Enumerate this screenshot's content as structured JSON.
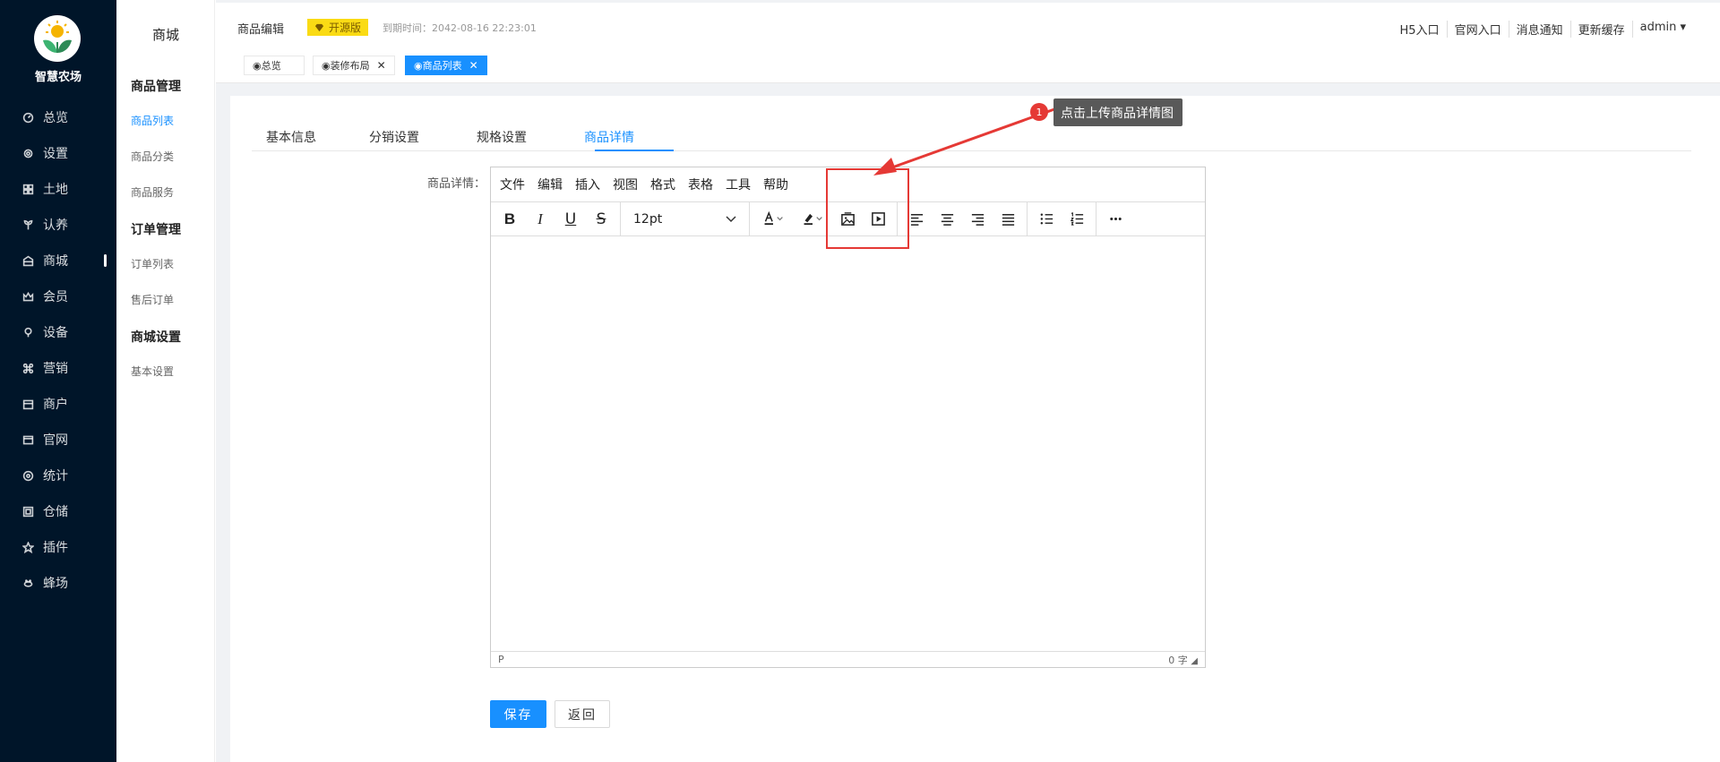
{
  "brand": {
    "name": "智慧农场"
  },
  "sidebar": {
    "items": [
      {
        "label": "总览",
        "icon": "dashboard-icon"
      },
      {
        "label": "设置",
        "icon": "gear-icon"
      },
      {
        "label": "土地",
        "icon": "grid-icon"
      },
      {
        "label": "认养",
        "icon": "sprout-icon"
      },
      {
        "label": "商城",
        "icon": "shop-icon"
      },
      {
        "label": "会员",
        "icon": "crown-icon"
      },
      {
        "label": "设备",
        "icon": "device-icon"
      },
      {
        "label": "营销",
        "icon": "command-icon"
      },
      {
        "label": "商户",
        "icon": "store-icon"
      },
      {
        "label": "官网",
        "icon": "window-icon"
      },
      {
        "label": "统计",
        "icon": "target-icon"
      },
      {
        "label": "仓储",
        "icon": "box-icon"
      },
      {
        "label": "插件",
        "icon": "star-icon"
      },
      {
        "label": "蜂场",
        "icon": "bee-icon"
      }
    ]
  },
  "subnav": {
    "title": "商城",
    "groups": [
      {
        "title": "商品管理",
        "items": [
          "商品列表",
          "商品分类",
          "商品服务"
        ]
      },
      {
        "title": "订单管理",
        "items": [
          "订单列表",
          "售后订单"
        ]
      },
      {
        "title": "商城设置",
        "items": [
          "基本设置"
        ]
      }
    ]
  },
  "topbar": {
    "page_title": "商品编辑",
    "badge": "开源版",
    "expire": "到期时间：2042-08-16 22:23:01",
    "links": [
      "H5入口",
      "官网入口",
      "消息通知",
      "更新缓存",
      "admin ▾"
    ]
  },
  "tags": [
    {
      "label": "◉总览"
    },
    {
      "label": "◉装修布局"
    },
    {
      "label": "◉商品列表"
    }
  ],
  "tabs": [
    "基本信息",
    "分销设置",
    "规格设置",
    "商品详情"
  ],
  "form": {
    "label": "商品详情：",
    "menu": [
      "文件",
      "编辑",
      "插入",
      "视图",
      "格式",
      "表格",
      "工具",
      "帮助"
    ],
    "font_size": "12pt",
    "status_left": "P",
    "status_right": "0 字"
  },
  "annotation": {
    "step": "1",
    "text": "点击上传商品详情图"
  },
  "buttons": {
    "save": "保存",
    "back": "返回"
  },
  "colors": {
    "primary": "#1890ff",
    "sidebar": "#001529",
    "annotation": "#e53935"
  }
}
